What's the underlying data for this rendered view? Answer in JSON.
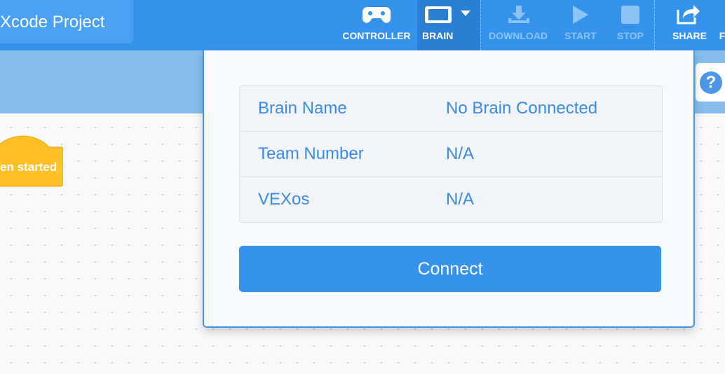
{
  "toolbar": {
    "project_title": "Xcode Project",
    "controller_label": "CONTROLLER",
    "brain_label": "BRAIN",
    "download_label": "DOWNLOAD",
    "start_label": "START",
    "stop_label": "STOP",
    "share_label": "SHARE",
    "overflow_label": "F"
  },
  "workspace": {
    "hat_block_label": "en started"
  },
  "brain_panel": {
    "rows": [
      {
        "key": "Brain Name",
        "value": "No Brain Connected"
      },
      {
        "key": "Team Number",
        "value": "N/A"
      },
      {
        "key": "VEXos",
        "value": "N/A"
      }
    ],
    "connect_label": "Connect"
  },
  "help": {
    "icon": "?"
  },
  "colors": {
    "toolbar": "#3593ee",
    "accent_text": "#3a8be0",
    "hat_block": "#ffbf26"
  }
}
